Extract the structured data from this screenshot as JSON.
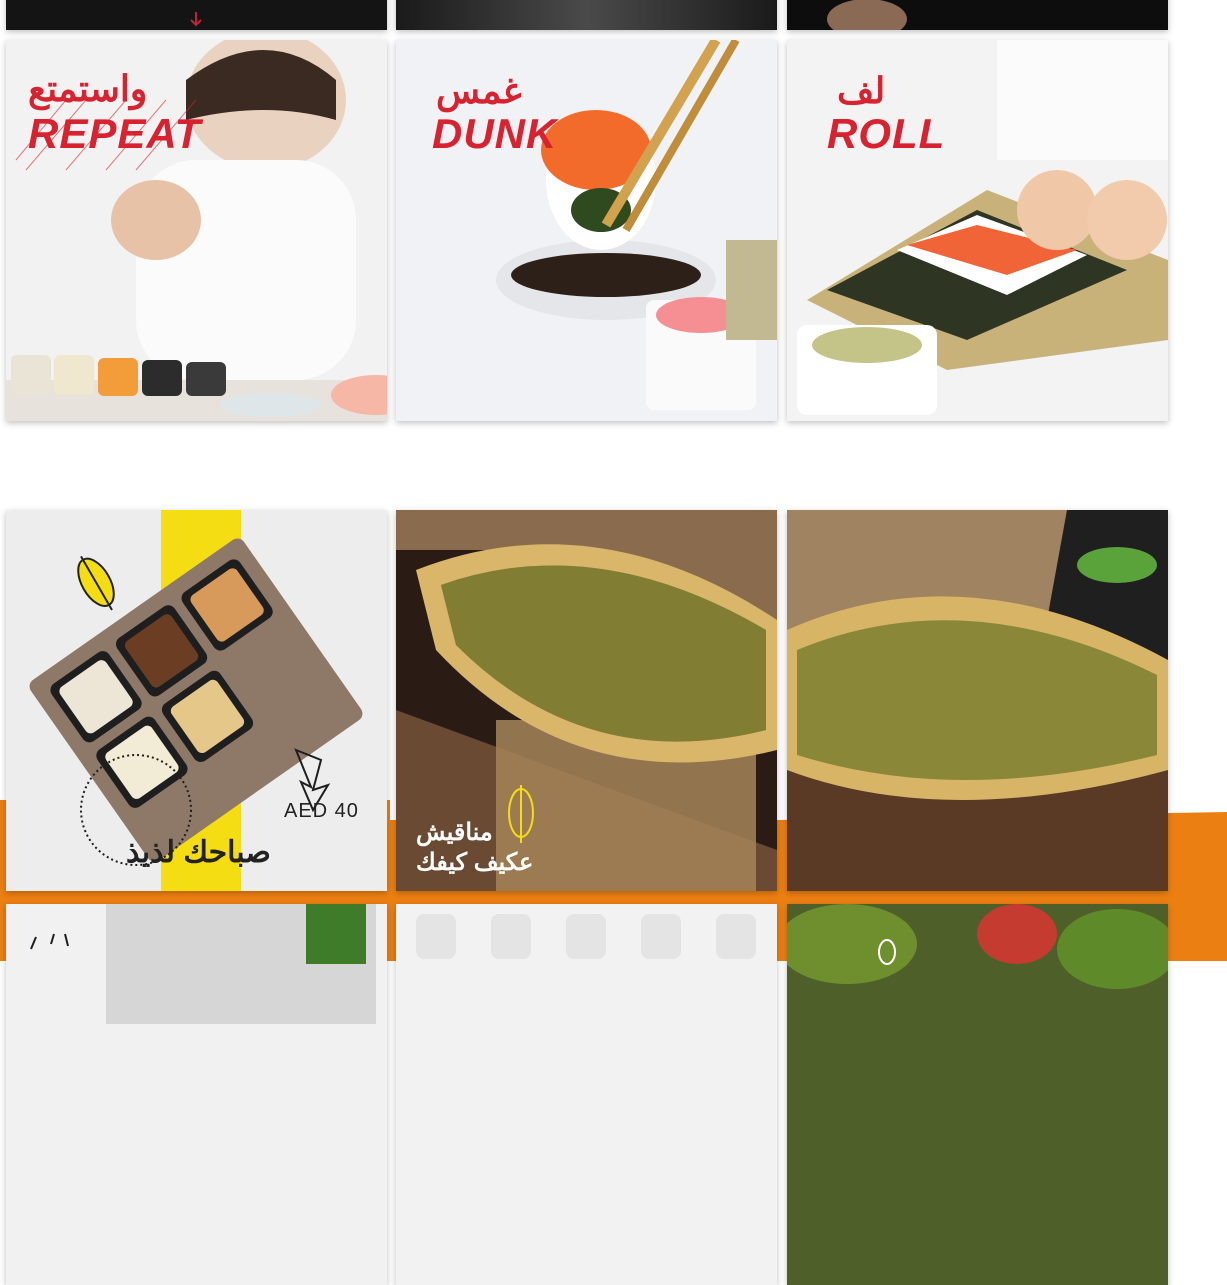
{
  "gallery": {
    "row_top": [
      {
        "name": "tile-dark-1"
      },
      {
        "name": "tile-dark-2"
      },
      {
        "name": "tile-dark-3"
      }
    ],
    "row_sushi": [
      {
        "arabic": "واستمتع",
        "english": "REPEAT"
      },
      {
        "arabic": "غمس",
        "english": "DUNK"
      },
      {
        "arabic": "لف",
        "english": "ROLL"
      }
    ],
    "row_food": [
      {
        "title": "صباحك لذيذ",
        "price": "AED 40"
      },
      {
        "line1": "مناقيش",
        "line2": "عكيف كيفك"
      },
      {}
    ]
  },
  "colors": {
    "accent_orange": "#ec7f12",
    "brand_red": "#d8222f",
    "promo_yellow": "#f5dd14"
  },
  "icons": [
    "down-arrow-icon",
    "shawarma-icon",
    "arrow-icon"
  ]
}
